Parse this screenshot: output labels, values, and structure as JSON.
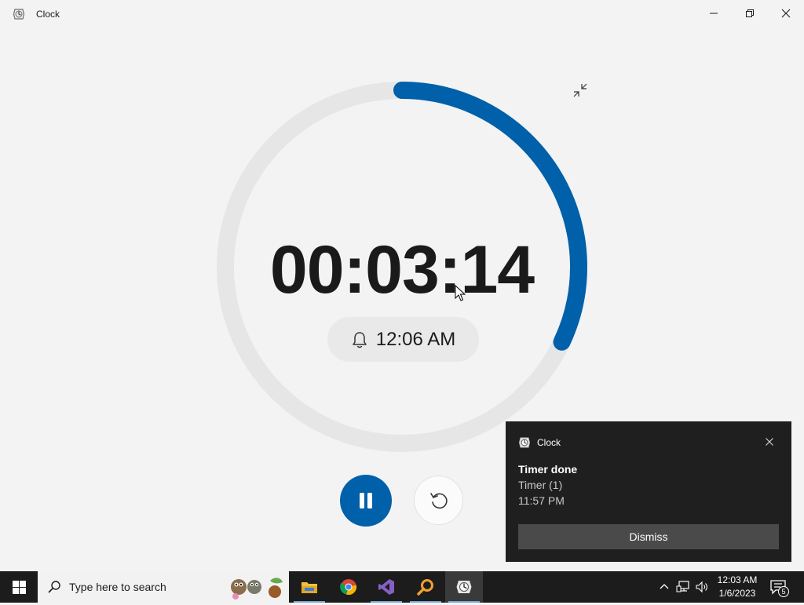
{
  "window": {
    "title": "Clock",
    "icon": "clock-app-icon",
    "controls": [
      "minimize-icon",
      "restore-icon",
      "close-icon"
    ]
  },
  "timer": {
    "remaining": "00:03:14",
    "progress_fraction": 0.32,
    "alarm_icon": "bell-icon",
    "alarm_time": "12:06 AM",
    "controls": {
      "pause_icon": "pause-icon",
      "reset_icon": "reset-icon",
      "compact_icon": "compact-overlay-icon"
    }
  },
  "toast": {
    "app_name": "Clock",
    "title": "Timer done",
    "line1": "Timer (1)",
    "line2": "11:57 PM",
    "dismiss_label": "Dismiss"
  },
  "taskbar": {
    "search_placeholder": "Type here to search",
    "apps": [
      "file-explorer-icon",
      "chrome-icon",
      "visual-studio-icon",
      "search-tool-icon",
      "clock-app-icon"
    ],
    "tray": {
      "time": "12:03 AM",
      "date": "1/6/2023",
      "notification_count": "5"
    }
  },
  "colors": {
    "accent": "#0060aa",
    "ring_track": "#e6e6e6",
    "toast_bg": "#1f1f1f",
    "taskbar_bg": "#1c1c1c"
  }
}
